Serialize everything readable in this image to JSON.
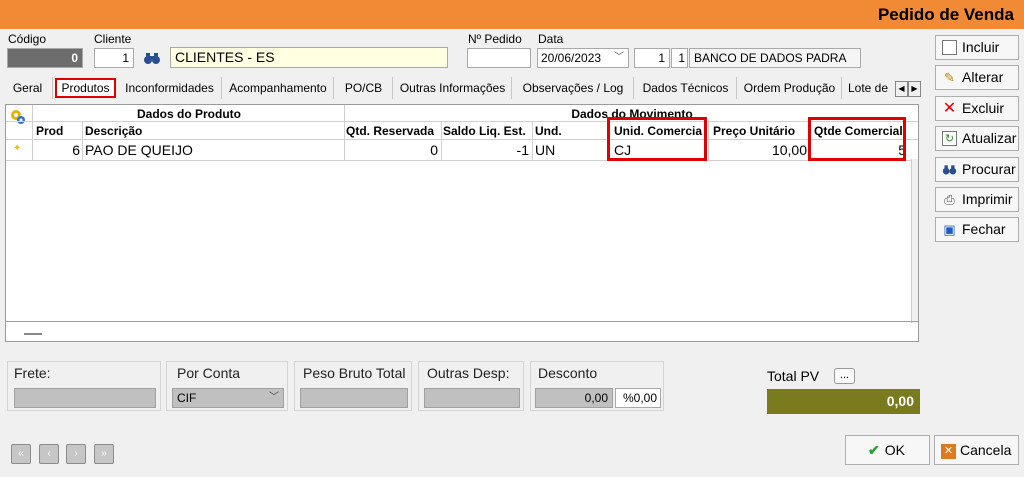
{
  "window": {
    "title": "Pedido de Venda"
  },
  "header": {
    "codigo_label": "Código",
    "codigo_value": "0",
    "cliente_label": "Cliente",
    "cliente_id": "1",
    "cliente_name": "CLIENTES - ES",
    "pedido_label": "Nº Pedido",
    "pedido_value": "",
    "data_label": "Data",
    "data_value": "20/06/2023",
    "db_num1": "1",
    "db_num2": "1",
    "db_name": "BANCO DE DADOS PADRA"
  },
  "tabs": [
    "Geral",
    "Produtos",
    "Inconformidades",
    "Acompanhamento",
    "PO/CB",
    "Outras Informações",
    "Observações / Log",
    "Dados Técnicos",
    "Ordem Produção",
    "Lote de"
  ],
  "grid": {
    "group_produto": "Dados do Produto",
    "group_movimento": "Dados do Movimento",
    "columns": [
      "Prod",
      "Descrição",
      "Qtd. Reservada",
      "Saldo Liq. Est.",
      "Und.",
      "Unid. Comercia",
      "Preço Unitário",
      "Qtde Comercial"
    ],
    "row": {
      "prod": "6",
      "descricao": "PAO DE QUEIJO",
      "qtd_reservada": "0",
      "saldo": "-1",
      "und": "UN",
      "unid_comercial": "CJ",
      "preco": "10,00",
      "qtde_comercial": "5"
    }
  },
  "footer": {
    "frete_label": "Frete:",
    "porconta_label": "Por Conta",
    "porconta_value": "CIF",
    "peso_label": "Peso Bruto Total",
    "outras_label": "Outras Desp:",
    "desconto_label": "Desconto",
    "desconto_value": "0,00",
    "desconto_pct": "%0,00",
    "totalpv_label": "Total PV",
    "totalpv_btn": "...",
    "totalpv_value": "0,00"
  },
  "sidebar": {
    "incluir": "Incluir",
    "alterar": "Alterar",
    "excluir": "Excluir",
    "atualizar": "Atualizar",
    "procurar": "Procurar",
    "imprimir": "Imprimir",
    "fechar": "Fechar"
  },
  "buttons": {
    "ok": "OK",
    "cancela": "Cancela"
  },
  "colors": {
    "titlebar": "#f08a34",
    "highlight": "#e00000",
    "total_bg": "#7a7a1e"
  }
}
